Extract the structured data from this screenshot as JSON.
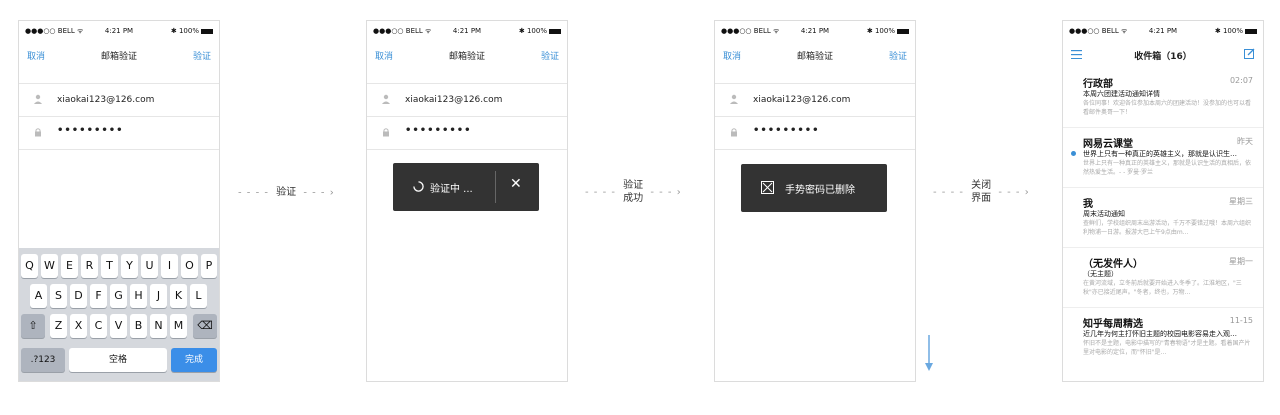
{
  "status": {
    "carrier": "●●●○○ BELL ᯤ",
    "time": "4:21 PM",
    "battery": "✱ 100%"
  },
  "verify_nav": {
    "cancel": "取消",
    "title": "邮箱验证",
    "verify": "验证"
  },
  "form": {
    "email": "xiaokai123@126.com",
    "password": "•••••••••"
  },
  "keyboard": {
    "row1": [
      "Q",
      "W",
      "E",
      "R",
      "T",
      "Y",
      "U",
      "I",
      "O",
      "P"
    ],
    "row2": [
      "A",
      "S",
      "D",
      "F",
      "G",
      "H",
      "J",
      "K",
      "L"
    ],
    "row3": [
      "Z",
      "X",
      "C",
      "V",
      "B",
      "N",
      "M"
    ],
    "numbers": ".?123",
    "space": "空格",
    "done": "完成"
  },
  "toast_loading": {
    "label": "验证中 ...",
    "close": "✕"
  },
  "toast_success": {
    "label": "手势密码已删除"
  },
  "flow": {
    "step1": "验证",
    "step2_line1": "验证",
    "step2_line2": "成功",
    "step3_line1": "关闭",
    "step3_line2": "界面"
  },
  "inbox": {
    "title": "收件箱（16）",
    "items": [
      {
        "sender": "行政部",
        "time": "02:07",
        "subject": "本周六团建活动通知详情",
        "preview": "各位同事！欢迎各位参加本周六的团建活动！没参加的也可以看看邮件奥哥一下！"
      },
      {
        "sender": "网易云课堂",
        "time": "昨天",
        "subject": "世界上只有一种真正的英雄主义，那就是认识生…",
        "preview": "世界上只有一种真正的英雄主义，那就是认识生活的真相后，依然热爱生活。- - 罗曼·罗兰"
      },
      {
        "sender": "我",
        "time": "星期三",
        "subject": "周末活动通知",
        "preview": "查鲜们，学校组织周末出游活动，千万不要错过哦！本周六组织利物浦一日游。报游大巴上午9点由m…"
      },
      {
        "sender": "（无发件人）",
        "time": "星期一",
        "subject": "（无主题）",
        "preview": "在黄河流域，立冬前后就要开始进入冬季了。江淮地区，\"三秋\"亦已接近尾声。\"冬者，终也，万物…"
      },
      {
        "sender": "知乎每周精选",
        "time": "11-15",
        "subject": "近几年为何主打怀旧主题的校园电影容易走入观…",
        "preview": "怀旧不是主题，电影中描写的\"青春物语\"才是主题。看着国产片里对电影的定位，而\"怀旧\"是…"
      }
    ]
  },
  "colors": {
    "accent": "#3a8fd6",
    "toast": "#333333",
    "keyboard": "#d5d8dd"
  }
}
